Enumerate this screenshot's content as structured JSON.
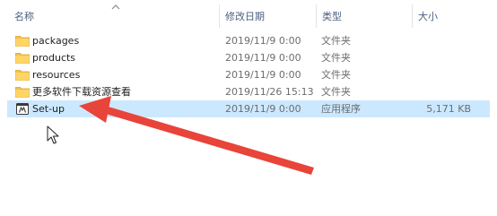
{
  "columns": {
    "name": "名称",
    "date": "修改日期",
    "type": "类型",
    "size": "大小"
  },
  "files": [
    {
      "name": "packages",
      "date": "2019/11/9 0:00",
      "type": "文件夹",
      "size": "",
      "icon": "folder-icon",
      "selected": false
    },
    {
      "name": "products",
      "date": "2019/11/9 0:00",
      "type": "文件夹",
      "size": "",
      "icon": "folder-icon",
      "selected": false
    },
    {
      "name": "resources",
      "date": "2019/11/9 0:00",
      "type": "文件夹",
      "size": "",
      "icon": "folder-icon",
      "selected": false
    },
    {
      "name": "更多软件下载资源查看",
      "date": "2019/11/26 15:13",
      "type": "文件夹",
      "size": "",
      "icon": "folder-icon",
      "selected": false
    },
    {
      "name": "Set-up",
      "date": "2019/11/9 0:00",
      "type": "应用程序",
      "size": "5,171 KB",
      "icon": "app-icon",
      "selected": true
    }
  ],
  "colors": {
    "selection": "#cce8ff",
    "folder": "#f5c04a",
    "arrow": "#e8443a",
    "header_text": "#4d6082"
  }
}
